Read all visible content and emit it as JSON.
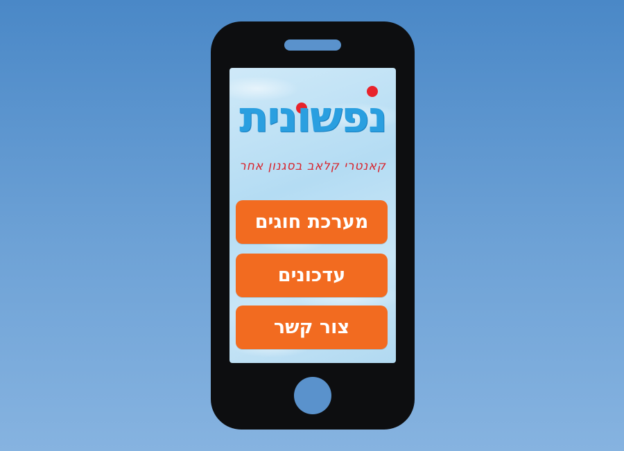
{
  "app": {
    "logo_title": "נפשונית",
    "tagline": "קאנטרי קלאב בסגנון אחר"
  },
  "menu": [
    {
      "label": "מערכת חוגים"
    },
    {
      "label": "עדכונים"
    },
    {
      "label": "צור קשר"
    }
  ],
  "colors": {
    "background": "#5a92cc",
    "phone_body": "#0d0e10",
    "button": "#f26b20",
    "button_text": "#ffffff",
    "logo": "#2a9fe0",
    "logo_dots": "#e8232b",
    "tagline": "#d8232b"
  }
}
